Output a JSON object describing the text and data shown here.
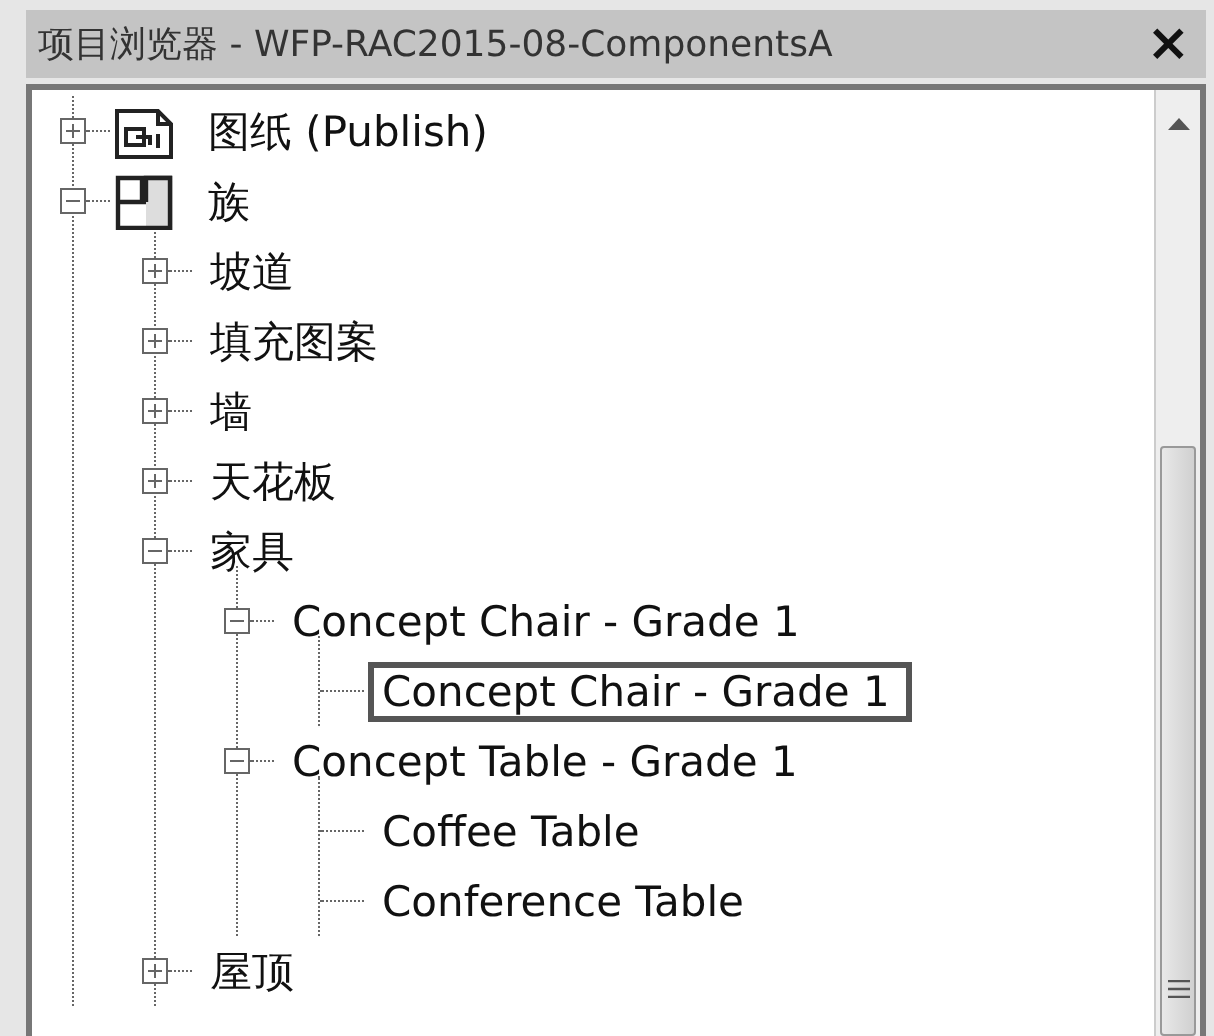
{
  "panel": {
    "title": "项目浏览器 - WFP-RAC2015-08-ComponentsA",
    "close": "×"
  },
  "tree": [
    {
      "label": "图纸 (Publish)",
      "kind": "sheets",
      "expanded": false,
      "selected": false
    },
    {
      "label": "族",
      "kind": "family",
      "expanded": true,
      "selected": false,
      "children": [
        {
          "label": "坡道",
          "expanded": false,
          "selected": false
        },
        {
          "label": "填充图案",
          "expanded": false,
          "selected": false
        },
        {
          "label": "墙",
          "expanded": false,
          "selected": false
        },
        {
          "label": "天花板",
          "expanded": false,
          "selected": false
        },
        {
          "label": "家具",
          "expanded": true,
          "selected": false,
          "children": [
            {
              "label": "Concept Chair - Grade 1",
              "expanded": true,
              "selected": false,
              "children": [
                {
                  "label": "Concept Chair - Grade 1",
                  "selected": true
                }
              ]
            },
            {
              "label": "Concept Table - Grade 1",
              "expanded": true,
              "selected": false,
              "children": [
                {
                  "label": "Coffee Table",
                  "selected": false
                },
                {
                  "label": "Conference Table",
                  "selected": false
                }
              ]
            }
          ]
        },
        {
          "label": "屋顶",
          "expanded": false,
          "selected": false
        }
      ]
    }
  ]
}
